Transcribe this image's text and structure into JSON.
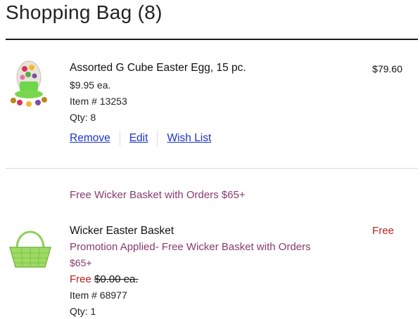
{
  "page": {
    "title": "Shopping Bag",
    "count": "(8)"
  },
  "items": [
    {
      "name": "Assorted G Cube Easter Egg, 15 pc.",
      "unit_price": "$9.95 ea.",
      "item_number": "Item # 13253",
      "qty": "Qty: 8",
      "total": "$79.60",
      "actions": {
        "remove": "Remove",
        "edit": "Edit",
        "wishlist": "Wish List"
      }
    },
    {
      "promo_header": "Free Wicker Basket with Orders $65+",
      "name": "Wicker Easter Basket",
      "promo_line1": "Promotion Applied- Free Wicker Basket with Orders",
      "promo_line2": "$65+",
      "free_label": "Free",
      "original_price": "$0.00 ea.",
      "item_number": "Item # 68977",
      "qty": "Qty: 1",
      "total": "Free"
    }
  ],
  "colors": {
    "link": "#1c34c8",
    "promo": "#8a3a6e",
    "free": "#b3221e"
  }
}
